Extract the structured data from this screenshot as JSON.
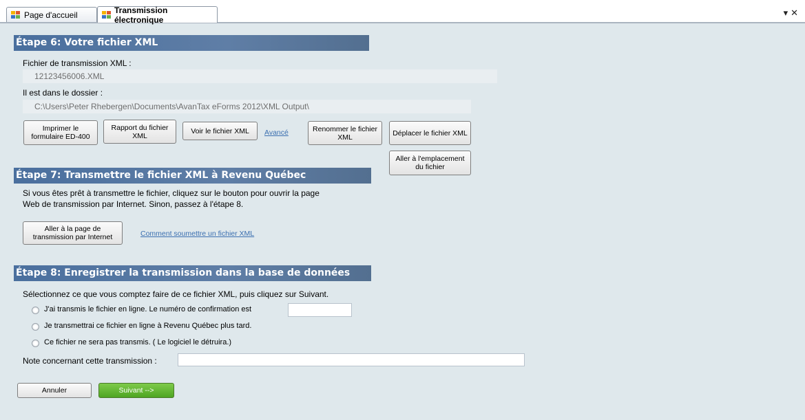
{
  "tabs": [
    {
      "label": "Page d'accueil",
      "icon": "windows-flag-icon"
    },
    {
      "label": "Transmission électronique",
      "icon": "windows-flag-icon"
    }
  ],
  "tab_controls": {
    "dropdown": "▾",
    "close": "✕"
  },
  "step6": {
    "title": "Étape 6: Votre fichier XML",
    "file_label": "Fichier de transmission XML :",
    "file_value": "12123456006.XML",
    "folder_label": "Il est dans le dossier :",
    "folder_value": "C:\\Users\\Peter Rhebergen\\Documents\\AvanTax eForms 2012\\XML Output\\",
    "buttons": {
      "print": "Imprimer le formulaire ED-400",
      "report": "Rapport du fichier XML",
      "view": "Voir le fichier XML",
      "advanced": "Avancé",
      "rename": "Renommer le fichier XML",
      "move": "Déplacer le fichier XML",
      "goto": "Aller à l'emplacement du fichier"
    }
  },
  "step7": {
    "title": "Étape 7: Transmettre le fichier XML à Revenu Québec",
    "line1": "Si vous êtes prêt à transmettre le fichier, cliquez sur le bouton pour ouvrir la page",
    "line2": "Web de transmission par Internet. Sinon, passez à l'étape 8.",
    "goto_button": "Aller à la page de transmission par Internet",
    "howto_link": "Comment soumettre un fichier XML"
  },
  "step8": {
    "title": "Étape  8: Enregistrer la transmission dans la base de données",
    "instruction": "Sélectionnez ce que vous comptez faire de ce fichier XML, puis cliquez sur Suivant.",
    "options": [
      "J'ai transmis le fichier en ligne. Le numéro de confirmation est",
      "Je transmettrai ce fichier en ligne à Revenu Québec plus tard.",
      "Ce fichier ne sera pas transmis. ( Le logiciel le détruira.)"
    ],
    "confirmation_value": "",
    "note_label": "Note concernant cette transmission :",
    "note_value": ""
  },
  "footer": {
    "cancel": "Annuler",
    "next": "Suivant -->"
  }
}
